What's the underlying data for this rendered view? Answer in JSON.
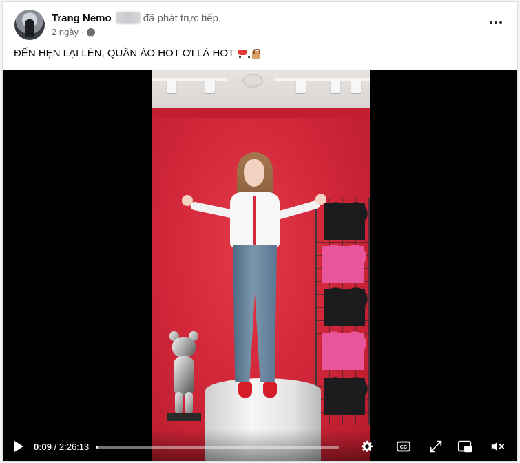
{
  "post": {
    "author": "Trang Nemo",
    "action_text": "đã phát trực tiếp.",
    "time_ago": "2 ngày",
    "separator": "·",
    "privacy_icon": "globe-icon",
    "more_icon": "more-options-icon",
    "caption": "ĐẾN HẸN LẠI LÊN, QUẦN ÁO HOT ƠI LÀ HOT",
    "caption_emojis": [
      "shopping-cart-emoji",
      "shopping-bag-emoji"
    ]
  },
  "video": {
    "current_time": "0:09",
    "time_separator": " / ",
    "duration": "2:26:13",
    "progress_fraction": 0.001,
    "controls": [
      "play-icon",
      "settings-gear-icon",
      "captions-icon",
      "fullscreen-icon",
      "picture-in-picture-icon",
      "mute-icon"
    ]
  },
  "colors": {
    "card_bg": "#ffffff",
    "page_bg": "#f0f2f5",
    "secondary_text": "#65676b",
    "backdrop_red": "#d3283a"
  }
}
